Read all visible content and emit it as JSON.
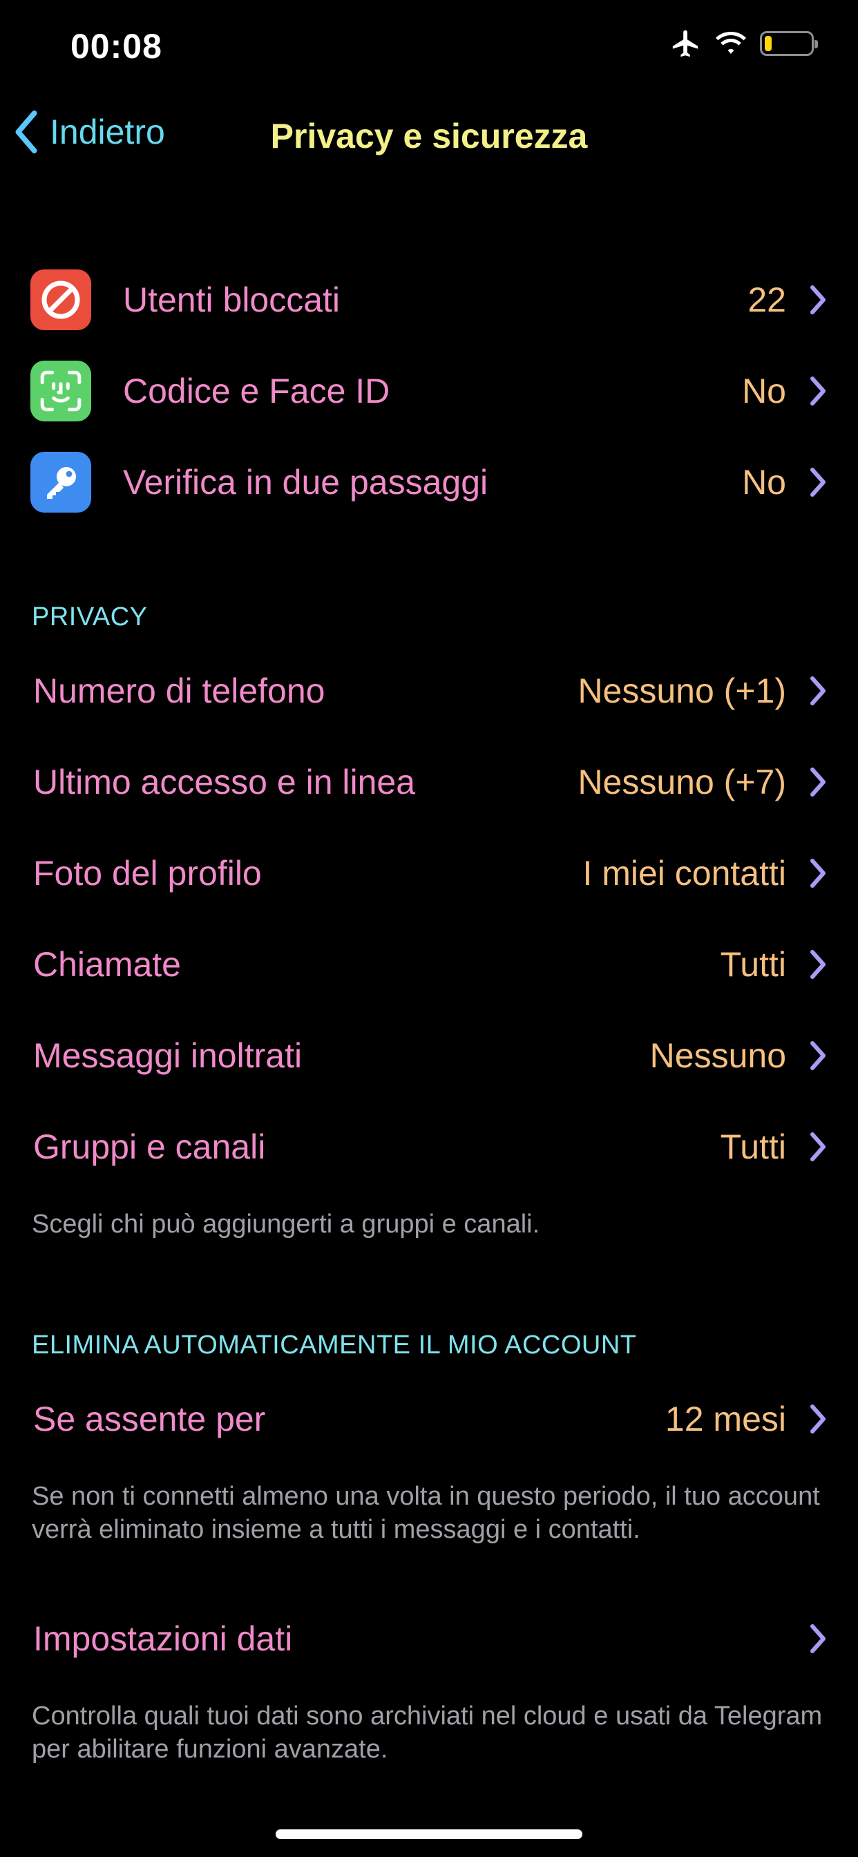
{
  "status_bar": {
    "time": "00:08",
    "icons": [
      "airplane-icon",
      "wifi-icon",
      "battery-icon"
    ],
    "battery_level": 0.15,
    "battery_color": "#ffd60a"
  },
  "nav": {
    "back_label": "Indietro",
    "title": "Privacy e sicurezza"
  },
  "security": {
    "items": [
      {
        "label": "Utenti bloccati",
        "value": "22",
        "icon": "blocked-icon",
        "icon_color": "#eb4d3d"
      },
      {
        "label": "Codice e Face ID",
        "value": "No",
        "icon": "face-id-icon",
        "icon_color": "#5cd16a"
      },
      {
        "label": "Verifica in due passaggi",
        "value": "No",
        "icon": "key-icon",
        "icon_color": "#3f8cf0"
      }
    ]
  },
  "privacy": {
    "header": "PRIVACY",
    "items": [
      {
        "label": "Numero di telefono",
        "value": "Nessuno (+1)"
      },
      {
        "label": "Ultimo accesso e in linea",
        "value": "Nessuno (+7)"
      },
      {
        "label": "Foto del profilo",
        "value": "I miei contatti"
      },
      {
        "label": "Chiamate",
        "value": "Tutti"
      },
      {
        "label": "Messaggi inoltrati",
        "value": "Nessuno"
      },
      {
        "label": "Gruppi e canali",
        "value": "Tutti"
      }
    ],
    "footer": "Scegli chi può aggiungerti a gruppi e canali."
  },
  "delete_account": {
    "header": "ELIMINA AUTOMATICAMENTE IL MIO ACCOUNT",
    "item": {
      "label": "Se assente per",
      "value": "12 mesi"
    },
    "footer": "Se non ti connetti almeno una volta in questo periodo, il tuo account verrà eliminato insieme a tutti i messaggi e i contatti."
  },
  "data_settings": {
    "item": {
      "label": "Impostazioni dati"
    },
    "footer": "Controlla quali tuoi dati sono archiviati nel cloud e usati da Telegram per abilitare funzioni avanzate."
  },
  "colors": {
    "label": "#f08ac9",
    "value": "#f6c080",
    "chevron": "#a99cf5",
    "accent": "#66d9ee",
    "title": "#f3f08a"
  }
}
